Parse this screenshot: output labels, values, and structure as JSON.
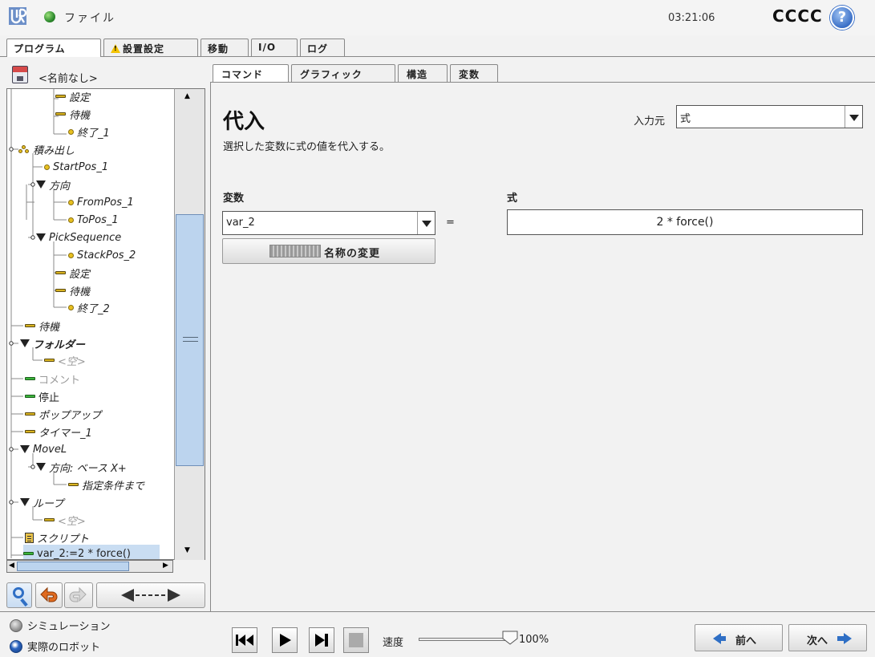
{
  "topbar": {
    "file_menu": "ファイル",
    "clock": "03:21:06",
    "robot_name": "CCCC",
    "help": "?"
  },
  "main_tabs": [
    {
      "label": "プログラム",
      "active": true
    },
    {
      "label": "設置設定",
      "warning": true
    },
    {
      "label": "移動"
    },
    {
      "label": "I/O"
    },
    {
      "label": "ログ"
    }
  ],
  "program": {
    "name": "<名前なし>"
  },
  "tree": [
    {
      "label": "設定",
      "icon": "bar-yellow"
    },
    {
      "label": "待機",
      "icon": "bar-yellow"
    },
    {
      "label": "終了_1",
      "icon": "dot-yellow"
    },
    {
      "label": "積み出し",
      "icon": "pallet-dots"
    },
    {
      "label": "StartPos_1",
      "icon": "dot-yellow"
    },
    {
      "label": "方向",
      "icon": "triangle"
    },
    {
      "label": "FromPos_1",
      "icon": "dot-yellow"
    },
    {
      "label": "ToPos_1",
      "icon": "dot-yellow"
    },
    {
      "label": "PickSequence",
      "icon": "triangle"
    },
    {
      "label": "StackPos_2",
      "icon": "dot-yellow"
    },
    {
      "label": "設定",
      "icon": "bar-yellow"
    },
    {
      "label": "待機",
      "icon": "bar-yellow"
    },
    {
      "label": "終了_2",
      "icon": "dot-yellow"
    },
    {
      "label": "待機",
      "icon": "bar-yellow"
    },
    {
      "label": "フォルダー",
      "icon": "triangle"
    },
    {
      "label": "<空>",
      "icon": "bar-gray"
    },
    {
      "label": "コメント",
      "icon": "bar-green"
    },
    {
      "label": "停止",
      "icon": "bar-green"
    },
    {
      "label": "ポップアップ",
      "icon": "bar-yellow"
    },
    {
      "label": "タイマー_1",
      "icon": "bar-yellow"
    },
    {
      "label": "MoveL",
      "icon": "triangle"
    },
    {
      "label": "方向: ベース X+",
      "icon": "triangle"
    },
    {
      "label": "指定条件まで",
      "icon": "bar-yellow"
    },
    {
      "label": "ループ",
      "icon": "triangle"
    },
    {
      "label": "<空>",
      "icon": "bar-gray"
    },
    {
      "label": "スクリプト",
      "icon": "script"
    },
    {
      "label": "var_2:=2 * force()",
      "icon": "bar-green",
      "selected": true
    }
  ],
  "command_tabs": [
    {
      "label": "コマンド",
      "active": true
    },
    {
      "label": "グラフィック"
    },
    {
      "label": "構造"
    },
    {
      "label": "変数"
    }
  ],
  "command": {
    "title": "代入",
    "description": "選択した変数に式の値を代入する。",
    "source_label": "入力元",
    "source_value": "式",
    "variable_label": "変数",
    "variable_value": "var_2",
    "equals": "=",
    "expression_label": "式",
    "expression_value": "2 * force()",
    "rename_label": "名称の変更"
  },
  "footer": {
    "simulation_label": "シミュレーション",
    "real_robot_label": "実際のロボット",
    "speed_label": "速度",
    "speed_value": "100%",
    "speed_fraction": 1.0,
    "prev_label": "前へ",
    "next_label": "次へ"
  },
  "colors": {
    "selection": "#c9ddf2",
    "accent_blue": "#2f6fc5",
    "status_green": "#2e8b2e",
    "warning_yellow": "#f2c200"
  }
}
